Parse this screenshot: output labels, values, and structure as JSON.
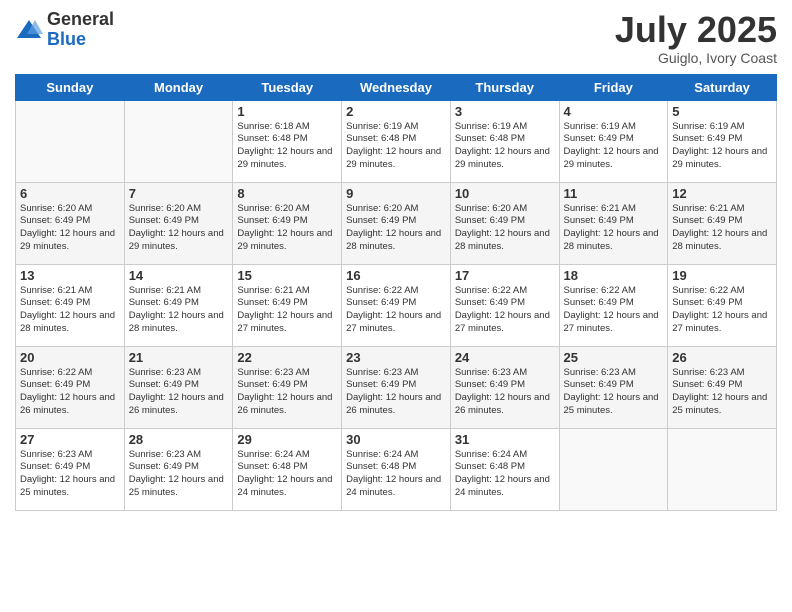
{
  "header": {
    "logo_general": "General",
    "logo_blue": "Blue",
    "month_title": "July 2025",
    "location": "Guiglo, Ivory Coast"
  },
  "weekdays": [
    "Sunday",
    "Monday",
    "Tuesday",
    "Wednesday",
    "Thursday",
    "Friday",
    "Saturday"
  ],
  "weeks": [
    [
      {
        "day": "",
        "info": ""
      },
      {
        "day": "",
        "info": ""
      },
      {
        "day": "1",
        "info": "Sunrise: 6:18 AM\nSunset: 6:48 PM\nDaylight: 12 hours and 29 minutes."
      },
      {
        "day": "2",
        "info": "Sunrise: 6:19 AM\nSunset: 6:48 PM\nDaylight: 12 hours and 29 minutes."
      },
      {
        "day": "3",
        "info": "Sunrise: 6:19 AM\nSunset: 6:48 PM\nDaylight: 12 hours and 29 minutes."
      },
      {
        "day": "4",
        "info": "Sunrise: 6:19 AM\nSunset: 6:49 PM\nDaylight: 12 hours and 29 minutes."
      },
      {
        "day": "5",
        "info": "Sunrise: 6:19 AM\nSunset: 6:49 PM\nDaylight: 12 hours and 29 minutes."
      }
    ],
    [
      {
        "day": "6",
        "info": "Sunrise: 6:20 AM\nSunset: 6:49 PM\nDaylight: 12 hours and 29 minutes."
      },
      {
        "day": "7",
        "info": "Sunrise: 6:20 AM\nSunset: 6:49 PM\nDaylight: 12 hours and 29 minutes."
      },
      {
        "day": "8",
        "info": "Sunrise: 6:20 AM\nSunset: 6:49 PM\nDaylight: 12 hours and 29 minutes."
      },
      {
        "day": "9",
        "info": "Sunrise: 6:20 AM\nSunset: 6:49 PM\nDaylight: 12 hours and 28 minutes."
      },
      {
        "day": "10",
        "info": "Sunrise: 6:20 AM\nSunset: 6:49 PM\nDaylight: 12 hours and 28 minutes."
      },
      {
        "day": "11",
        "info": "Sunrise: 6:21 AM\nSunset: 6:49 PM\nDaylight: 12 hours and 28 minutes."
      },
      {
        "day": "12",
        "info": "Sunrise: 6:21 AM\nSunset: 6:49 PM\nDaylight: 12 hours and 28 minutes."
      }
    ],
    [
      {
        "day": "13",
        "info": "Sunrise: 6:21 AM\nSunset: 6:49 PM\nDaylight: 12 hours and 28 minutes."
      },
      {
        "day": "14",
        "info": "Sunrise: 6:21 AM\nSunset: 6:49 PM\nDaylight: 12 hours and 28 minutes."
      },
      {
        "day": "15",
        "info": "Sunrise: 6:21 AM\nSunset: 6:49 PM\nDaylight: 12 hours and 27 minutes."
      },
      {
        "day": "16",
        "info": "Sunrise: 6:22 AM\nSunset: 6:49 PM\nDaylight: 12 hours and 27 minutes."
      },
      {
        "day": "17",
        "info": "Sunrise: 6:22 AM\nSunset: 6:49 PM\nDaylight: 12 hours and 27 minutes."
      },
      {
        "day": "18",
        "info": "Sunrise: 6:22 AM\nSunset: 6:49 PM\nDaylight: 12 hours and 27 minutes."
      },
      {
        "day": "19",
        "info": "Sunrise: 6:22 AM\nSunset: 6:49 PM\nDaylight: 12 hours and 27 minutes."
      }
    ],
    [
      {
        "day": "20",
        "info": "Sunrise: 6:22 AM\nSunset: 6:49 PM\nDaylight: 12 hours and 26 minutes."
      },
      {
        "day": "21",
        "info": "Sunrise: 6:23 AM\nSunset: 6:49 PM\nDaylight: 12 hours and 26 minutes."
      },
      {
        "day": "22",
        "info": "Sunrise: 6:23 AM\nSunset: 6:49 PM\nDaylight: 12 hours and 26 minutes."
      },
      {
        "day": "23",
        "info": "Sunrise: 6:23 AM\nSunset: 6:49 PM\nDaylight: 12 hours and 26 minutes."
      },
      {
        "day": "24",
        "info": "Sunrise: 6:23 AM\nSunset: 6:49 PM\nDaylight: 12 hours and 26 minutes."
      },
      {
        "day": "25",
        "info": "Sunrise: 6:23 AM\nSunset: 6:49 PM\nDaylight: 12 hours and 25 minutes."
      },
      {
        "day": "26",
        "info": "Sunrise: 6:23 AM\nSunset: 6:49 PM\nDaylight: 12 hours and 25 minutes."
      }
    ],
    [
      {
        "day": "27",
        "info": "Sunrise: 6:23 AM\nSunset: 6:49 PM\nDaylight: 12 hours and 25 minutes."
      },
      {
        "day": "28",
        "info": "Sunrise: 6:23 AM\nSunset: 6:49 PM\nDaylight: 12 hours and 25 minutes."
      },
      {
        "day": "29",
        "info": "Sunrise: 6:24 AM\nSunset: 6:48 PM\nDaylight: 12 hours and 24 minutes."
      },
      {
        "day": "30",
        "info": "Sunrise: 6:24 AM\nSunset: 6:48 PM\nDaylight: 12 hours and 24 minutes."
      },
      {
        "day": "31",
        "info": "Sunrise: 6:24 AM\nSunset: 6:48 PM\nDaylight: 12 hours and 24 minutes."
      },
      {
        "day": "",
        "info": ""
      },
      {
        "day": "",
        "info": ""
      }
    ]
  ]
}
